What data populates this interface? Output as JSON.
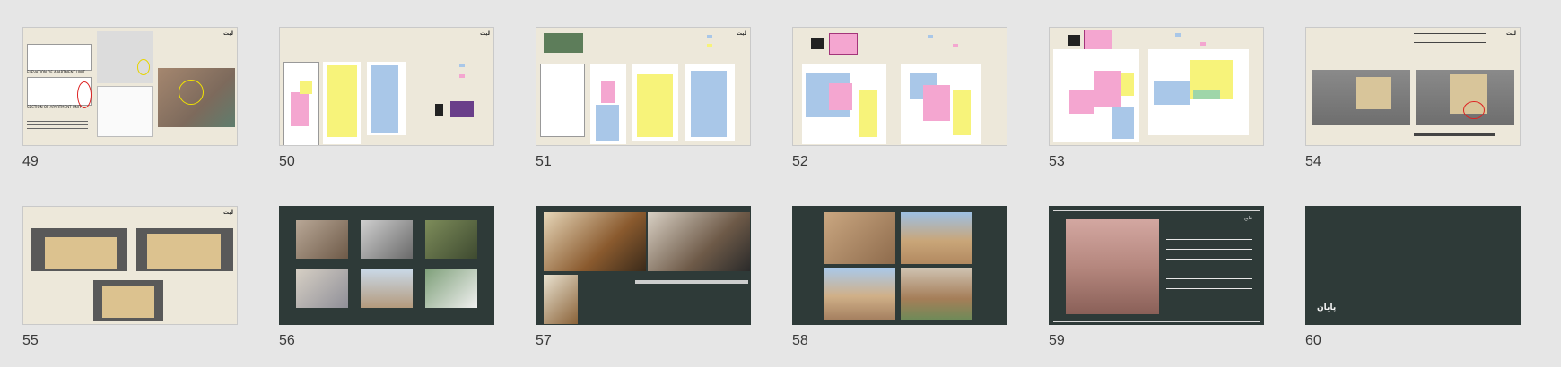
{
  "slides": [
    {
      "num": "49"
    },
    {
      "num": "50"
    },
    {
      "num": "51"
    },
    {
      "num": "52"
    },
    {
      "num": "53"
    },
    {
      "num": "54"
    },
    {
      "num": "55"
    },
    {
      "num": "56"
    },
    {
      "num": "57"
    },
    {
      "num": "58"
    },
    {
      "num": "59"
    },
    {
      "num": "60"
    }
  ],
  "logo_text": "لیت",
  "s49": {
    "label1": "ELEVATION OF APARTMENT UNIT",
    "label2": "SECTION OF APARTMENT UNIT"
  },
  "s60": {
    "title": "پایان"
  },
  "s59": {
    "heading": "نتایج"
  },
  "colors": {
    "beige": "#ede8da",
    "dark": "#2e3a38",
    "pink": "#f4a6d0",
    "yellow": "#f7f37a",
    "blue": "#a9c7e8",
    "green": "#9fd6a9"
  }
}
